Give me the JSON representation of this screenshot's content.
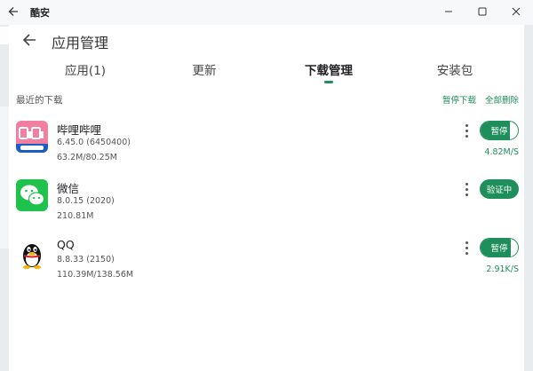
{
  "window": {
    "title": "酷安",
    "back_icon": "back-arrow-icon",
    "controls": [
      "minimize-icon",
      "maximize-icon",
      "close-icon"
    ]
  },
  "page": {
    "title": "应用管理"
  },
  "tabs": [
    {
      "label": "应用(1)",
      "active": false
    },
    {
      "label": "更新",
      "active": false
    },
    {
      "label": "下载管理",
      "active": true
    },
    {
      "label": "安装包",
      "active": false
    }
  ],
  "section": {
    "title": "最近的下载",
    "pause_all": "暂停下载",
    "delete_all": "全部删除"
  },
  "downloads": [
    {
      "name": "哔哩哔哩",
      "version": "6.45.0 (6450400)",
      "size": "63.2M/80.25M",
      "progress": 0.79,
      "button": "暂停",
      "speed": "4.82M/S",
      "icon": "bilibili-icon"
    },
    {
      "name": "微信",
      "version": "8.0.15 (2020)",
      "size": "210.81M",
      "progress": 1.0,
      "button": "验证中",
      "speed": "",
      "icon": "wechat-icon"
    },
    {
      "name": "QQ",
      "version": "8.8.33 (2150)",
      "size": "110.39M/138.56M",
      "progress": 0.8,
      "button": "暂停",
      "speed": "2.91K/S",
      "icon": "qq-icon"
    }
  ],
  "colors": {
    "accent": "#1e8f5a",
    "bilibili_pink": "#f27ea0",
    "wechat_green": "#1fc24b"
  }
}
